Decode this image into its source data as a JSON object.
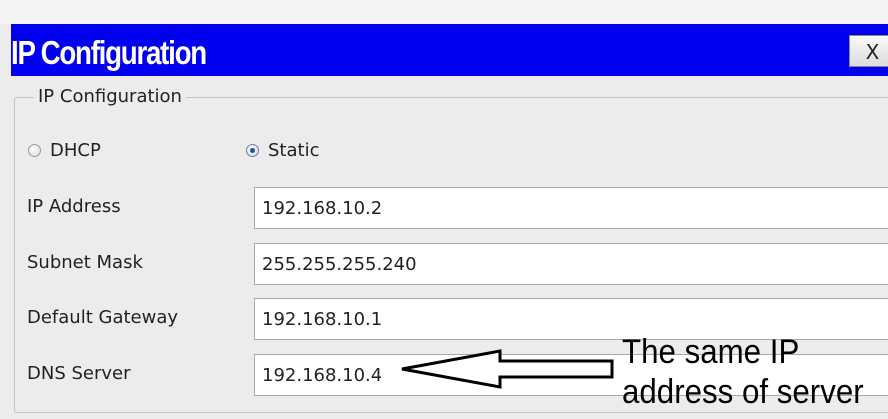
{
  "window": {
    "title": "IP Configuration",
    "close_label": "X"
  },
  "group": {
    "legend": "IP Configuration"
  },
  "mode": {
    "options": [
      {
        "label": "DHCP",
        "selected": false
      },
      {
        "label": "Static",
        "selected": true
      }
    ]
  },
  "fields": {
    "ip_address": {
      "label": "IP Address",
      "value": "192.168.10.2"
    },
    "subnet_mask": {
      "label": "Subnet Mask",
      "value": "255.255.255.240"
    },
    "default_gateway": {
      "label": "Default Gateway",
      "value": "192.168.10.1"
    },
    "dns_server": {
      "label": "DNS Server",
      "value": "192.168.10.4"
    }
  },
  "annotation": {
    "line1": "The same IP",
    "line2": "address of server"
  },
  "colors": {
    "titlebar": "#0000ee",
    "title_text": "#ffffff",
    "background": "#ececec"
  }
}
